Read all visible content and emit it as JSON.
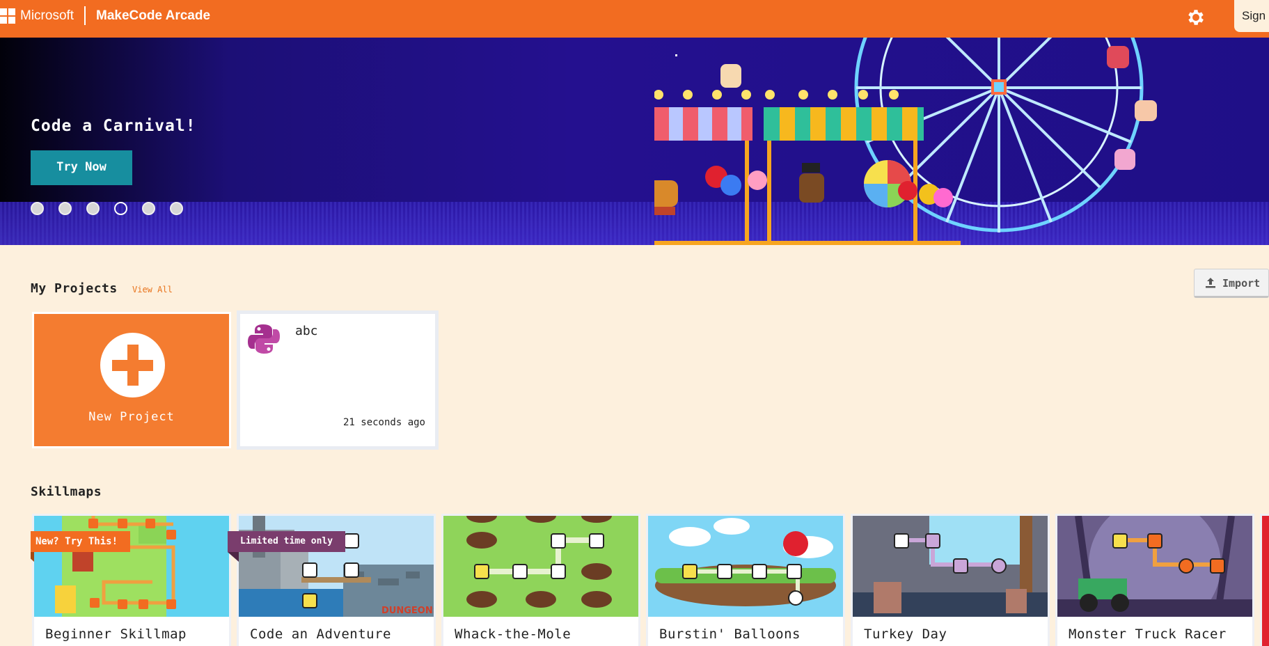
{
  "header": {
    "brand": "Microsoft",
    "app_title": "MakeCode Arcade",
    "settings_icon": "gear-icon",
    "sign_in_label": "Sign I"
  },
  "hero": {
    "title": "Code a Carnival!",
    "button_label": "Try Now",
    "carousel_count": 6,
    "carousel_active_index": 3
  },
  "my_projects": {
    "title": "My Projects",
    "view_all_label": "View All",
    "import_label": "Import",
    "new_project_label": "New Project",
    "projects": [
      {
        "name": "abc",
        "language_icon": "python-icon",
        "time": "21 seconds ago"
      }
    ]
  },
  "skillmaps": {
    "title": "Skillmaps",
    "items": [
      {
        "name": "Beginner Skillmap",
        "ribbon": "New? Try This!"
      },
      {
        "name": "Code an Adventure",
        "ribbon": "Limited time only"
      },
      {
        "name": "Whack-the-Mole",
        "ribbon": ""
      },
      {
        "name": "Burstin' Balloons",
        "ribbon": ""
      },
      {
        "name": "Turkey Day",
        "ribbon": ""
      },
      {
        "name": "Monster Truck Racer",
        "ribbon": ""
      }
    ]
  },
  "colors": {
    "header_orange": "#f26c21",
    "page_background": "#fdf0dd",
    "button_teal": "#178e9f",
    "card_orange": "#f47c30",
    "accent_link": "#e8731c"
  }
}
